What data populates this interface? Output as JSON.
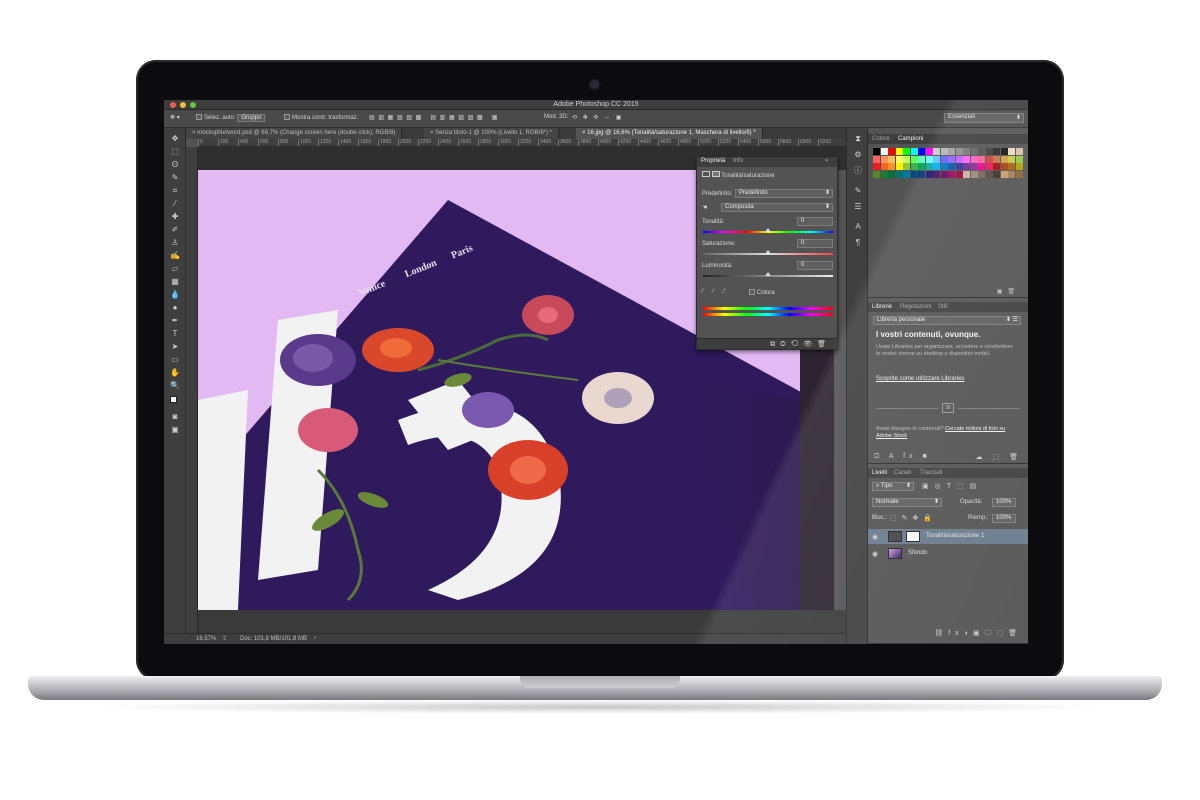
{
  "app": {
    "title": "Adobe Photoshop CC 2015",
    "workspace": "Essenziali"
  },
  "options_bar": {
    "auto_select_label": "Selez. auto:",
    "auto_select_value": "Gruppo",
    "transform_label": "Mostra contr. trasformaz.",
    "mode3d_label": "Mod. 3D:"
  },
  "tabs": [
    {
      "label": "mockupNetword.psd @ 66,7% (Change screen here (doube click), RGB/8)",
      "active": false
    },
    {
      "label": "Senza titolo-1 @ 100% (Livello 1, RGB/8*) *",
      "active": false
    },
    {
      "label": "16.jpg @ 16,6% (Tonalità/saturazione 1, Maschera di livello/8) *",
      "active": true
    }
  ],
  "ruler_ticks": [
    "0",
    "200",
    "400",
    "600",
    "800",
    "1000",
    "1200",
    "1400",
    "1600",
    "1800",
    "2000",
    "2200",
    "2400",
    "2600",
    "2800",
    "3000",
    "3200",
    "3400",
    "3600",
    "3800",
    "4000",
    "4200",
    "4400",
    "4600",
    "4800",
    "5000",
    "5200",
    "5400",
    "5600",
    "5800",
    "6000",
    "6200"
  ],
  "artwork": {
    "cities": [
      "Venice",
      "London",
      "Paris"
    ]
  },
  "status": {
    "zoom": "16,57%",
    "doc": "Doc: 101,8 MB/101,8 MB"
  },
  "properties": {
    "tab_properties": "Proprietà",
    "tab_info": "Info",
    "adjustment": "Tonalità/saturazione",
    "preset_label": "Predefinito:",
    "preset_value": "Predefinito",
    "channel_value": "Composita",
    "hue_label": "Tonalità:",
    "hue_value": "0",
    "saturation_label": "Saturazione:",
    "saturation_value": "0",
    "lightness_label": "Luminosità:",
    "lightness_value": "0",
    "colorize_label": "Colora"
  },
  "swatches_panel": {
    "tab_color": "Colore",
    "tab_swatches": "Campioni",
    "colors": [
      "#000000",
      "#ffffff",
      "#ff0000",
      "#ffff00",
      "#00ff00",
      "#00ffff",
      "#0000ff",
      "#ff00ff",
      "#c8c8c8",
      "#b4b4b4",
      "#a0a0a0",
      "#8c8c8c",
      "#787878",
      "#646464",
      "#505050",
      "#3c3c3c",
      "#282828",
      "#141414",
      "#e8d8c0",
      "#d8c0a0",
      "#ff6060",
      "#ff9060",
      "#ffc060",
      "#ffff60",
      "#c0ff60",
      "#60ff60",
      "#60ffc0",
      "#60ffff",
      "#60c0ff",
      "#6060ff",
      "#9060ff",
      "#c060ff",
      "#ff60ff",
      "#ff60c0",
      "#ff6090",
      "#c84040",
      "#c87040",
      "#c8a040",
      "#c8c840",
      "#90c840",
      "#ed1c24",
      "#f26522",
      "#f7941d",
      "#fff200",
      "#8dc63f",
      "#39b54a",
      "#00a651",
      "#00a99d",
      "#00aeef",
      "#0072bc",
      "#0054a6",
      "#2e3192",
      "#662d91",
      "#92278f",
      "#ec008c",
      "#ed145b",
      "#9e0b0f",
      "#a0410d",
      "#a36209",
      "#aba000",
      "#598527",
      "#197b30",
      "#007236",
      "#00746b",
      "#0076a3",
      "#004a80",
      "#003471",
      "#1b1464",
      "#440e62",
      "#630460",
      "#9e005d",
      "#9e0039",
      "#c7b299",
      "#998675",
      "#736357",
      "#534741",
      "#37302a",
      "#c69c6d",
      "#a67c52",
      "#8c6239"
    ]
  },
  "libraries_panel": {
    "tab_libraries": "Librerie",
    "tab_adjustments": "Regolazioni",
    "tab_styles": "Stili",
    "library_select": "Libreria personale",
    "heading": "I vostri contenuti, ovunque.",
    "body": "Usate Libraries per organizzare, accedere e condividere le vostre risorse su desktop e dispositivi mobili.",
    "link": "Scoprite come utilizzare Libraries",
    "badge": "St",
    "stock_text": "Avete bisogno di contenuti?",
    "stock_link": "Cercate milioni di foto su Adobe Stock"
  },
  "layers_panel": {
    "tab_layers": "Livelli",
    "tab_channels": "Canali",
    "tab_paths": "Tracciati",
    "filter": "Tipo",
    "blend_mode": "Normale",
    "opacity_label": "Opacità:",
    "opacity_value": "100%",
    "lock_label": "Bloc.:",
    "fill_label": "Riemp.:",
    "fill_value": "100%",
    "layers": [
      {
        "name": "Tonalità/saturazione 1",
        "selected": true
      },
      {
        "name": "Sfondo",
        "selected": false
      }
    ]
  }
}
